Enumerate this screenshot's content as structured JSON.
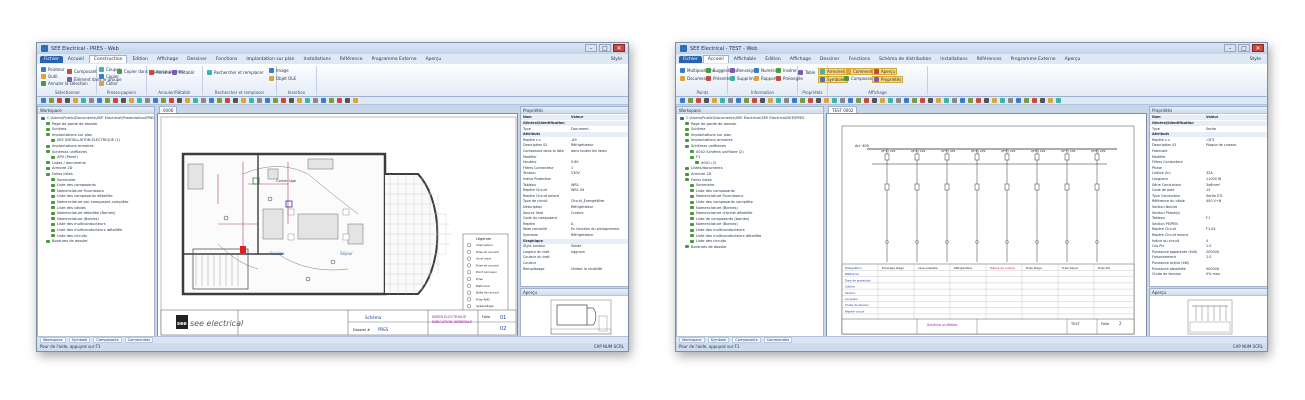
{
  "window1": {
    "title": "SEE Electrical - PRES - Web",
    "menu": [
      "Fichier",
      "Accueil",
      "Construction",
      "Édition",
      "Affichage",
      "Dessiner",
      "Fonctions",
      "Implantation sur plan",
      "Installations",
      "Référence",
      "Programme Externe",
      "Aperçu"
    ],
    "style_label": "Style",
    "ribbon_groups": [
      "Sélectionner",
      "Presse-papiers",
      "Annuler/Rétablir",
      "Rechercher et remplacer",
      "Insertion"
    ],
    "ribbon_buttons": [
      "Pointeur",
      "Outil",
      "Annuler la sélection",
      "Composant",
      "Élément dans le groupe",
      "Couper",
      "Copier",
      "Coller",
      "Copier dans le presse-papiers",
      "Annuler",
      "Rétablir",
      "Rechercher et remplacer",
      "Image",
      "Objet OLE"
    ],
    "workspace_title": "Workspace",
    "tree": [
      "C:\\Users\\Public\\Documents\\SEE Electrical\\Presentation\\PRES.sep",
      "Page de garde de dossier",
      "Schéma",
      "Implantations sur plan",
      "SEE INSTALLATION ÉLECTRIQUE (1)",
      "Implantations armoires",
      "Schémas unifilaires",
      "APV (Panel)",
      "Listes / documents",
      "Armoire 2D",
      "Folios listes",
      "Sommaire",
      "Liste des composants",
      "Nomenclature Fournisseur",
      "Liste des composants détaillée",
      "Nomenclature par composant complète",
      "Liste des câbles",
      "Nomenclature détaillée (Bornes)",
      "Nomenclature (Bornes)",
      "Liste des multiconducteurs",
      "Liste des multiconducteurs détaillée",
      "Liste des circuits",
      "Bordures de dossier"
    ],
    "doc_tab": "0006",
    "props_title": "Propriétés",
    "props_cols": [
      "Nom",
      "Valeur"
    ],
    "props": [
      {
        "k": "Général/Identification",
        "v": "",
        "group": true
      },
      {
        "k": "Type",
        "v": "Document"
      },
      {
        "k": "Attributs",
        "v": "",
        "group": true
      },
      {
        "k": "Repère c.c.",
        "v": "-A9"
      },
      {
        "k": "Description ID",
        "v": "Réfrigérateur"
      },
      {
        "k": "Composant dans la liste",
        "v": "dans toutes les listes"
      },
      {
        "k": "Modifier",
        "v": ""
      },
      {
        "k": "Hauteur",
        "v": "0.60"
      },
      {
        "k": "Filtres Connecteur",
        "v": "1"
      },
      {
        "k": "Tension",
        "v": "230V"
      },
      {
        "k": "Indice Protection",
        "v": ""
      },
      {
        "k": "Tableau",
        "v": "WR1"
      },
      {
        "k": "Repère Circuit",
        "v": "WR1.04"
      },
      {
        "k": "Repère Circuit amont",
        "v": ""
      },
      {
        "k": "Type de circuit",
        "v": "Circuit_ÉnergieWire"
      },
      {
        "k": "Description",
        "v": "Réfrigérateur"
      },
      {
        "k": "Source libre",
        "v": "Cuisine"
      },
      {
        "k": "Code du composant",
        "v": ""
      },
      {
        "k": "Repère",
        "v": "A"
      },
      {
        "k": "Note conseillé",
        "v": "En fonction du pictogramme"
      },
      {
        "k": "Symbole",
        "v": "Réfrigérateur"
      },
      {
        "k": "Graphique",
        "v": "",
        "group": true
      },
      {
        "k": "Style contour",
        "v": "Solide"
      },
      {
        "k": "Largeur du trait",
        "v": "hggnxm"
      },
      {
        "k": "Couleur du trait",
        "v": ""
      },
      {
        "k": "Couleur",
        "v": ""
      },
      {
        "k": "Remplissage",
        "v": "Utiliser la visibilité"
      }
    ],
    "apercu_title": "Aperçu",
    "bottom_tabs": [
      "Workspace",
      "Symbole",
      "Composants",
      "Commandes"
    ],
    "status": "Pour de l'aide, appuyez sur F1",
    "zoom": "CAP NUM SCRL",
    "plan": {
      "room_left": "Cuisine",
      "room_right": "Séjour",
      "corner_label": "Corner sige",
      "brand": "see electrical",
      "title_block": {
        "sheet": "Schéma",
        "doc": "IMSEN ÉLECTRIQUE",
        "sub": "INDICATION GÉNÉRALE",
        "folio_label": "Folio",
        "folio": "01",
        "dossier_label": "Dossier #",
        "dossier": "PRES",
        "total": "02"
      },
      "legend_title": "Légende",
      "legend": [
        "Interrupteur",
        "Prise de courant",
        "Va et vient",
        "Prise de courant",
        "Point lumineux",
        "Prise",
        "Plafonnier",
        "Boîte de raccord",
        "Prise RJ45",
        "Appareillage",
        "Prise de télévision",
        "Interphone",
        "Détecteur"
      ]
    }
  },
  "window2": {
    "title": "SEE Electrical - TEST - Web",
    "menu": [
      "Fichier",
      "Accueil",
      "Affichable",
      "Édition",
      "Affichage",
      "Dessiner",
      "Fonctions",
      "Schéma de distribution",
      "Installations",
      "Références",
      "Programme Externe",
      "Aperçu"
    ],
    "style_label": "Style",
    "ribbon_groups": [
      "Points",
      "Information",
      "Propriétés",
      "Affichage"
    ],
    "ribbon_buttons": [
      "Multipositions",
      "Document",
      "Suggestions",
      "Présenter",
      "Renseigner",
      "Supprimer",
      "Numéro",
      "Rapport",
      "Insérer",
      "Prolongée",
      "Table",
      "Armoires",
      "Symboles",
      "Commentaires",
      "Composants",
      "Aperçu",
      "Propriétés"
    ],
    "workspace_title": "Workspace",
    "tree": [
      "C:\\Users\\Public\\Documents\\SEE Electrical\\SEE Electrical\\SEE\\PRES",
      "Page de garde de dossier",
      "Schéma",
      "Implantations sur plan",
      "Implantations armoires",
      "Schémas unifilaires",
      "0002 Schéma unifilaire (2)",
      "F1",
      "0001 (2)",
      "Listes/documents",
      "Armoire 2D",
      "Folios listes",
      "Sommaire",
      "Liste des composants",
      "Nomenclature Fournisseur",
      "Liste des composants complète",
      "Nomenclature (Bornes)",
      "Nomenclature d'achat détaillée",
      "Liste de composants (bornes)",
      "Nomenclature (Bornes)",
      "Liste des multiconducteurs",
      "Liste des multiconducteurs détaillée",
      "Liste des circuits",
      "Bordures de dossier"
    ],
    "doc_tab": "TEST 0002",
    "props_title": "Propriétés",
    "props_cols": [
      "Nom",
      "Valeur"
    ],
    "props": [
      {
        "k": "Général/Identification",
        "v": "",
        "group": true
      },
      {
        "k": "Type",
        "v": "Sortie"
      },
      {
        "k": "Attributs",
        "v": "",
        "group": true
      },
      {
        "k": "Repère c.c.",
        "v": "-QF3"
      },
      {
        "k": "Description ID",
        "v": "Plaque de cuisson"
      },
      {
        "k": "Fabricant",
        "v": ""
      },
      {
        "k": "Modifier",
        "v": ""
      },
      {
        "k": "Filtres Conducteur",
        "v": ""
      },
      {
        "k": "Phase",
        "v": ""
      },
      {
        "k": "Calibre (In)",
        "v": "32A"
      },
      {
        "k": "Longueur",
        "v": "11000 W"
      },
      {
        "k": "Série Conducteur",
        "v": "3x6mm²"
      },
      {
        "k": "Code de pole",
        "v": "13"
      },
      {
        "k": "Type Conducteur",
        "v": "Sortie ETL"
      },
      {
        "k": "Référence du câble",
        "v": "400 V+N"
      },
      {
        "k": "Section Neutre",
        "v": ""
      },
      {
        "k": "Section Phase(s)",
        "v": ""
      },
      {
        "k": "Tableau",
        "v": "F1"
      },
      {
        "k": "Section PE/PEN",
        "v": ""
      },
      {
        "k": "Repère Circuit",
        "v": "F1.04"
      },
      {
        "k": "Repère Circuit amont",
        "v": ""
      },
      {
        "k": "Indice du circuit",
        "v": "4"
      },
      {
        "k": "Cos Phi",
        "v": "1.0"
      },
      {
        "k": "Puissance apparente (kVA)",
        "v": "2000VA"
      },
      {
        "k": "Foisonnement",
        "v": "1.0"
      },
      {
        "k": "Puissance active (kW)",
        "v": ""
      },
      {
        "k": "Puissance absorbée",
        "v": "5000VA"
      },
      {
        "k": "Chute de tension",
        "v": "0% max"
      }
    ],
    "apercu_title": "Aperçu",
    "bottom_tabs": [
      "Workspace",
      "Symbole",
      "Composants",
      "Commandes"
    ],
    "status": "Pour de l'aide, appuyez sur F1",
    "zoom": "CAP NUM SCRL",
    "diagram": {
      "supply": "Arr. 400",
      "breakers": [
        "QF1 | 2P2",
        "QF2 | 2P2",
        "QF3 | 4P1",
        "QF4 | 2P2",
        "QF5 | 2P2",
        "QF6 | 2P2",
        "QF7 | 2P2",
        "QF8 | 2P2"
      ],
      "circuits": [
        "Éclairage étage",
        "Lave-vaisselle",
        "Réfrigérateur",
        "Plaque de cuisson",
        "Prise étage",
        "Prise Séjour",
        "Prise lité"
      ],
      "row_labels": [
        "Désignation",
        "Référence",
        "Type de protection",
        "Calibre",
        "Section",
        "Longueur",
        "Chute de tension",
        "Repère circuit"
      ],
      "title_block": {
        "project": "Schéma unifilaire",
        "folio_label": "Folio",
        "folio": "2",
        "dossier": "TEST"
      }
    }
  }
}
